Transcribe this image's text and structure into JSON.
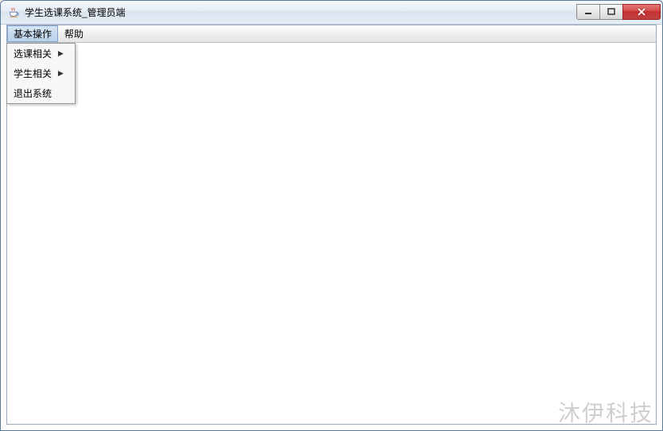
{
  "window": {
    "title": "学生选课系统_管理员端"
  },
  "menubar": {
    "items": [
      {
        "label": "基本操作",
        "active": true
      },
      {
        "label": "帮助",
        "active": false
      }
    ]
  },
  "dropdown": {
    "items": [
      {
        "label": "选课相关",
        "has_submenu": true
      },
      {
        "label": "学生相关",
        "has_submenu": true
      },
      {
        "label": "退出系统",
        "has_submenu": false
      }
    ]
  },
  "watermark": "沐伊科技"
}
